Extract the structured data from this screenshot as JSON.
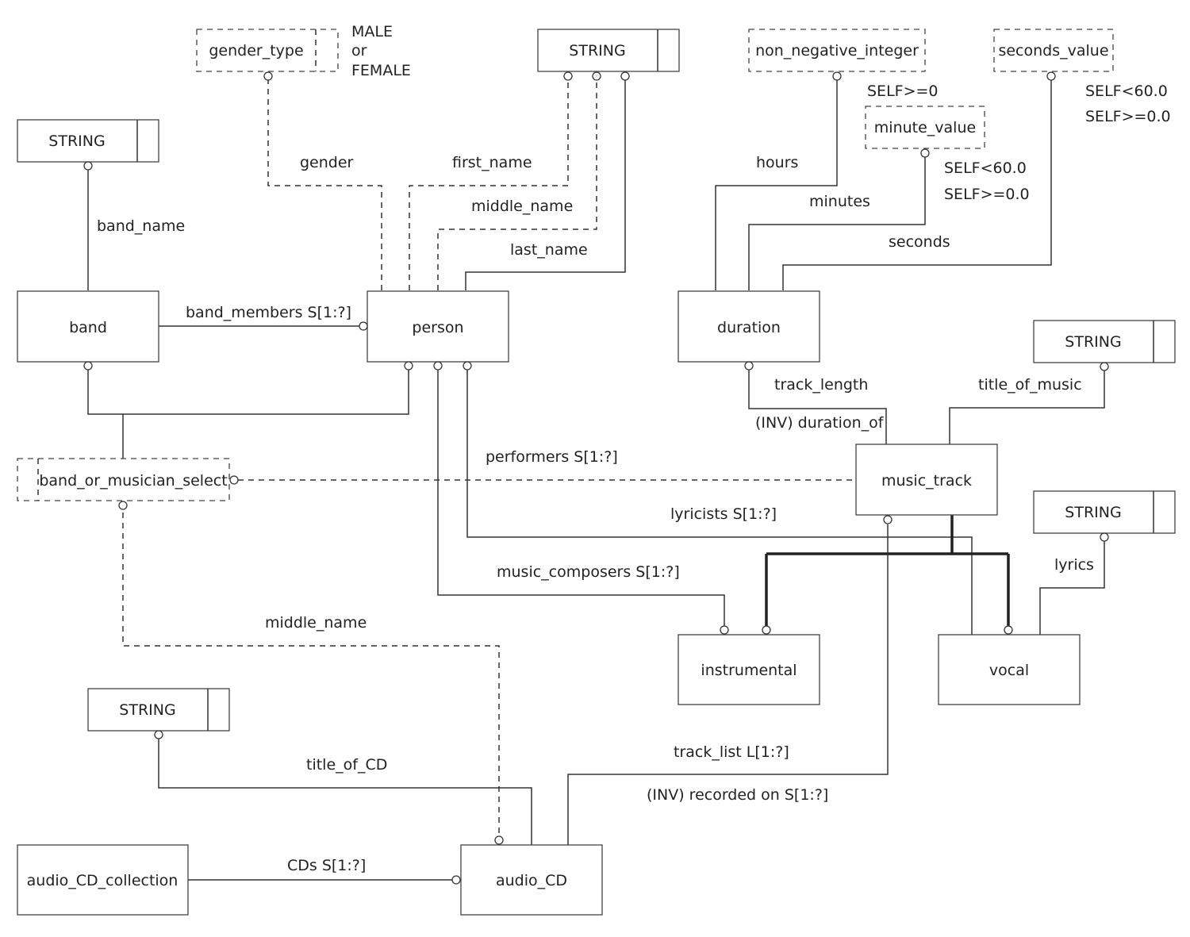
{
  "diagram": {
    "type": "EXPRESS-G data model",
    "entities": {
      "band": "band",
      "person": "person",
      "duration": "duration",
      "music_track": "music_track",
      "instrumental": "instrumental",
      "vocal": "vocal",
      "audio_cd_collection": "audio_CD_collection",
      "audio_cd": "audio_CD"
    },
    "types": {
      "string_band": "STRING",
      "string_person": "STRING",
      "string_title": "STRING",
      "string_lyrics": "STRING",
      "string_cd": "STRING",
      "gender_type": "gender_type",
      "non_negative_integer": "non_negative_integer",
      "minute_value": "minute_value",
      "seconds_value": "seconds_value",
      "band_or_musician_select": "band_or_musician_select"
    },
    "annotations": {
      "gender_values": [
        "MALE",
        "or",
        "FEMALE"
      ],
      "nni_rule": "SELF>=0",
      "minute_rules": [
        "SELF<60.0",
        "SELF>=0.0"
      ],
      "seconds_rules": [
        "SELF<60.0",
        "SELF>=0.0"
      ]
    },
    "relations": {
      "band_name": "band_name",
      "gender": "gender",
      "first_name": "first_name",
      "middle_name": "middle_name",
      "last_name": "last_name",
      "band_members": "band_members S[1:?]",
      "hours": "hours",
      "minutes": "minutes",
      "seconds": "seconds",
      "track_length": "track_length",
      "duration_of": "(INV) duration_of",
      "title_of_music": "title_of_music",
      "performers": "performers S[1:?]",
      "lyricists": "lyricists S[1:?]",
      "music_composers": "music_composers S[1:?]",
      "lyrics": "lyrics",
      "select_middle_name": "middle_name",
      "title_of_cd": "title_of_CD",
      "track_list": "track_list L[1:?]",
      "recorded_on": "(INV) recorded on S[1:?]",
      "cds": "CDs S[1:?]"
    }
  }
}
